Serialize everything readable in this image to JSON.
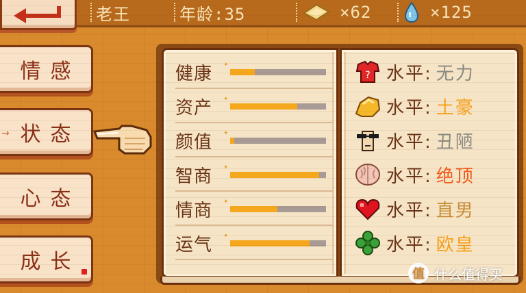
{
  "topbar": {
    "name": "老王",
    "age": "年龄:35",
    "gold_count": "×62",
    "water_count": "×125"
  },
  "menu": [
    {
      "label": "情感"
    },
    {
      "label": "状态",
      "prefix": "→"
    },
    {
      "label": "心态"
    },
    {
      "label": "成长"
    }
  ],
  "stats": [
    {
      "label": "健康",
      "level": 0.26
    },
    {
      "label": "资产",
      "level": 0.7
    },
    {
      "label": "颜值",
      "level": 0.04
    },
    {
      "label": "智商",
      "level": 0.93
    },
    {
      "label": "情商",
      "level": 0.49
    },
    {
      "label": "运气",
      "level": 0.83
    }
  ],
  "levels": [
    {
      "icon": "red-shirt-icon",
      "label": "水平:",
      "value": "无力",
      "color": "#8a8a80"
    },
    {
      "icon": "gold-nugget-icon",
      "label": "水平:",
      "value": "土豪",
      "color": "#f5a01a"
    },
    {
      "icon": "sunglasses-face-icon",
      "label": "水平:",
      "value": "丑陋",
      "color": "#8a8a80"
    },
    {
      "icon": "brain-icon",
      "label": "水平:",
      "value": "绝顶",
      "color": "#f05a1a"
    },
    {
      "icon": "heart-icon",
      "label": "水平:",
      "value": "直男",
      "color": "#c8903a"
    },
    {
      "icon": "clover-icon",
      "label": "水平:",
      "value": "欧皇",
      "color": "#f5a01a"
    }
  ],
  "watermark": "什么值得买",
  "watermark_logo": "值"
}
